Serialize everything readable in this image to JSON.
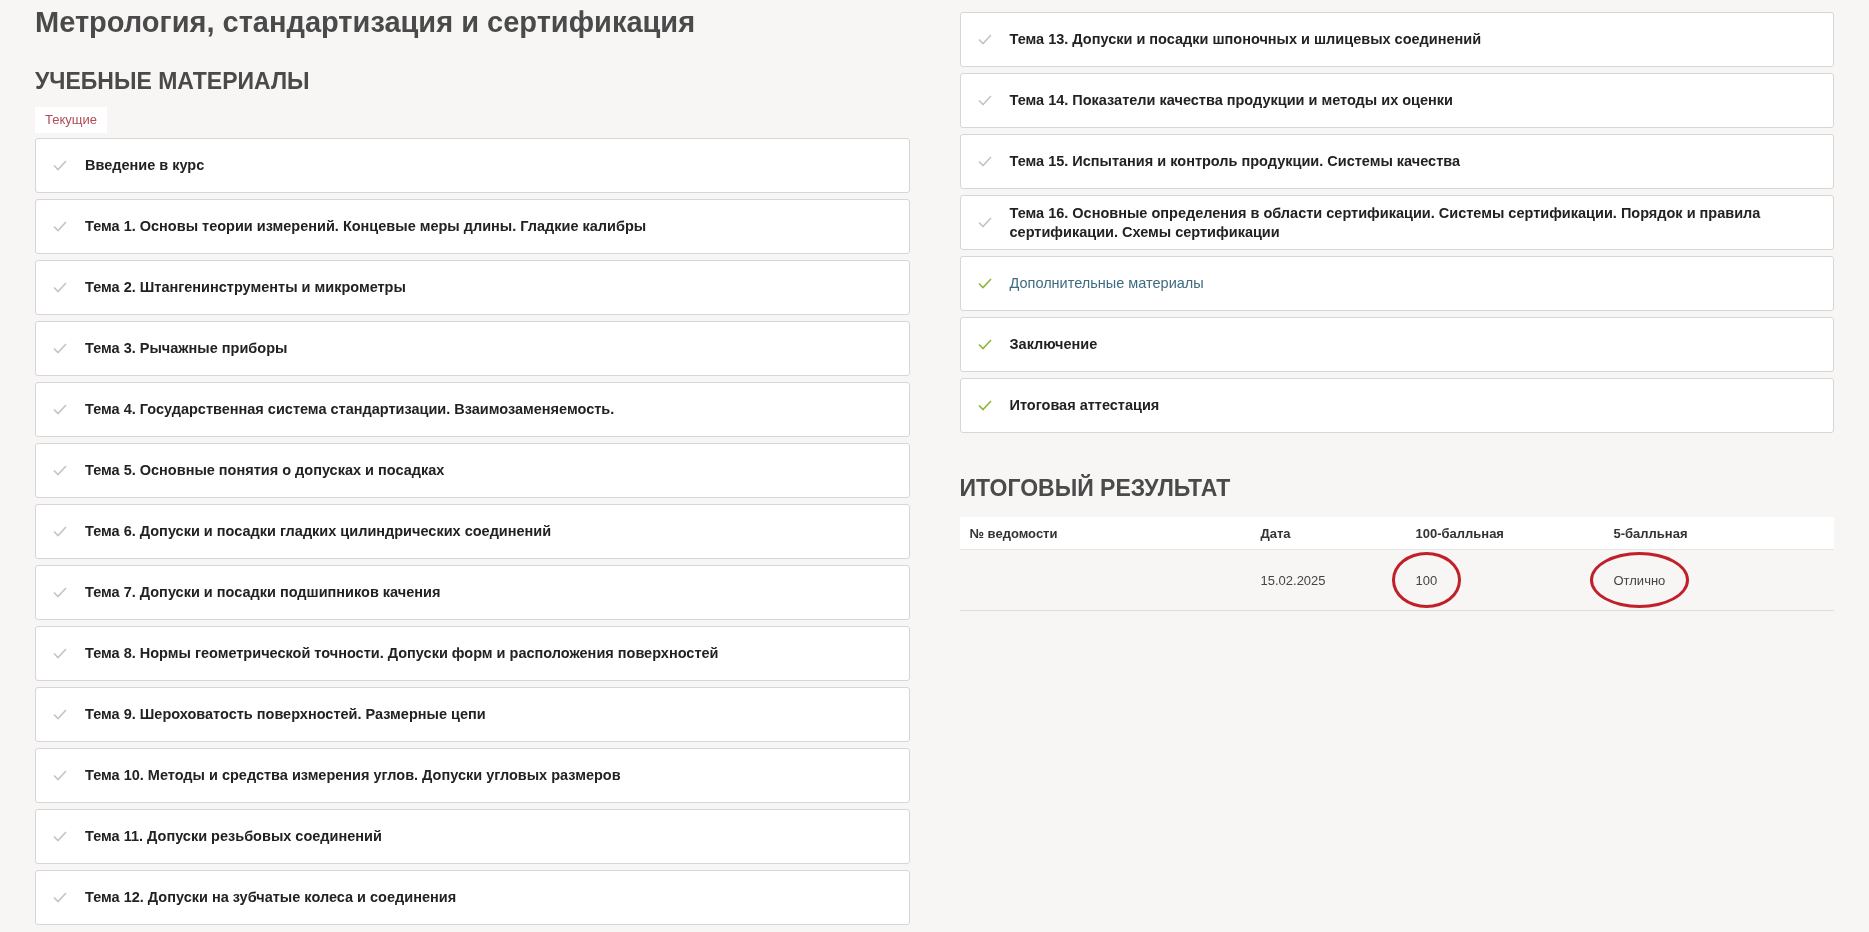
{
  "title": "Метрология, стандартизация и сертификация",
  "materials": {
    "heading": "УЧЕБНЫЕ МАТЕРИАЛЫ",
    "tabs": [
      {
        "label": "Текущие",
        "selected": true
      }
    ],
    "left_items": [
      {
        "label": "Введение в курс",
        "done": false,
        "kind": "topic"
      },
      {
        "label": "Тема 1. Основы теории измерений. Концевые меры длины. Гладкие калибры",
        "done": false,
        "kind": "topic"
      },
      {
        "label": "Тема 2. Штангенинструменты и микрометры",
        "done": false,
        "kind": "topic"
      },
      {
        "label": "Тема 3. Рычажные приборы",
        "done": false,
        "kind": "topic"
      },
      {
        "label": "Тема 4. Государственная система стандартизации. Взаимозаменяемость.",
        "done": false,
        "kind": "topic"
      },
      {
        "label": "Тема 5. Основные понятия о допусках и посадках",
        "done": false,
        "kind": "topic"
      },
      {
        "label": "Тема 6. Допуски и посадки гладких цилиндрических соединений",
        "done": false,
        "kind": "topic"
      },
      {
        "label": "Тема 7. Допуски и посадки подшипников качения",
        "done": false,
        "kind": "topic"
      },
      {
        "label": "Тема 8. Нормы геометрической точности. Допуски форм и расположения поверхностей",
        "done": false,
        "kind": "topic"
      },
      {
        "label": "Тема 9. Шероховатость поверхностей. Размерные цепи",
        "done": false,
        "kind": "topic"
      },
      {
        "label": "Тема 10. Методы и средства измерения углов. Допуски угловых размеров",
        "done": false,
        "kind": "topic"
      },
      {
        "label": "Тема 11. Допуски резьбовых соединений",
        "done": false,
        "kind": "topic"
      },
      {
        "label": "Тема 12. Допуски на зубчатые колеса и соединения",
        "done": false,
        "kind": "topic"
      }
    ],
    "right_items": [
      {
        "label": "Тема 13. Допуски и посадки шпоночных и шлицевых соединений",
        "done": false,
        "kind": "topic"
      },
      {
        "label": "Тема 14. Показатели качества продукции и методы их оценки",
        "done": false,
        "kind": "topic"
      },
      {
        "label": "Тема 15. Испытания и контроль продукции. Системы качества",
        "done": false,
        "kind": "topic"
      },
      {
        "label": "Тема 16. Основные определения в области сертификации. Системы сертификации. Порядок и правила сертификации. Схемы сертификации",
        "done": false,
        "kind": "topic"
      },
      {
        "label": "Дополнительные материалы",
        "done": true,
        "kind": "link"
      },
      {
        "label": "Заключение",
        "done": true,
        "kind": "topic"
      },
      {
        "label": "Итоговая аттестация",
        "done": true,
        "kind": "topic"
      }
    ]
  },
  "result": {
    "heading": "ИТОГОВЫЙ РЕЗУЛЬТАТ",
    "columns": [
      "№ ведомости",
      "Дата",
      "100-балльная",
      "5-балльная"
    ],
    "rows": [
      [
        null,
        {
          "text": "15.02.2025",
          "circled": false
        },
        {
          "text": "100",
          "circled": true
        },
        {
          "text": "Отлично",
          "circled": true
        }
      ]
    ]
  }
}
